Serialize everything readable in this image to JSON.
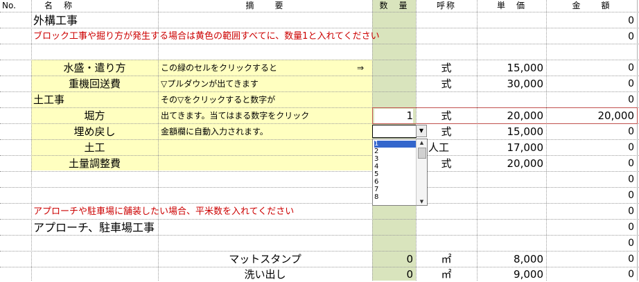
{
  "header": {
    "no": "No.",
    "name": "名　称",
    "summary": "摘　　要",
    "quantity": "数　量",
    "unit_name": "呼称",
    "unit_price": "単　価",
    "amount": "金　　額"
  },
  "rows": {
    "r1_name": "外構工事",
    "r1_amount": "0",
    "r2_notice": "ブロック工事や掘り方が発生する場合は黄色の範囲すべてに、数量1と入れてください",
    "r2_amount": "0",
    "r4_name": "水盛・遣り方",
    "r4_summary": "この緑のセルをクリックすると",
    "r4_arrow": "⇒",
    "r4_unit": "式",
    "r4_price": "15,000",
    "r4_amount": "0",
    "r5_name": "重機回送費",
    "r5_summary": "▽プルダウンが出てきます",
    "r5_unit": "式",
    "r5_price": "30,000",
    "r5_amount": "0",
    "r6_name": "土工事",
    "r6_summary": "その▽をクリックすると数字が",
    "r6_amount": "0",
    "r7_name": "堀方",
    "r7_summary": "出てきます。当てはまる数字をクリック",
    "r7_qty": "1",
    "r7_unit": "式",
    "r7_price": "20,000",
    "r7_amount": "20,000",
    "r8_name": "埋め戻し",
    "r8_summary": "金額欄に自動入力されます。",
    "r8_unit": "式",
    "r8_price": "15,000",
    "r8_amount": "0",
    "r9_name": "土工",
    "r9_unit": "人工",
    "r9_price": "17,000",
    "r9_amount": "0",
    "r10_name": "土量調整費",
    "r10_unit": "式",
    "r10_price": "20,000",
    "r10_amount": "0",
    "r11_amount": "0",
    "r12_amount": "0",
    "r13_notice": "アプローチや駐車場に舗装したい場合、平米数を入れてください",
    "r13_amount": "0",
    "r14_name": "アプローチ、駐車場工事",
    "r14_amount": "0",
    "r15_amount": "0",
    "r16_name": "マットスタンプ",
    "r16_qty": "0",
    "r16_unit": "㎡",
    "r16_price": "8,000",
    "r16_amount": "0",
    "r17_name": "洗い出し",
    "r17_qty": "0",
    "r17_unit": "㎡",
    "r17_price": "9,000",
    "r17_amount": "0"
  },
  "dropdown": {
    "options": [
      "1",
      "2",
      "3",
      "4",
      "5",
      "6",
      "7",
      "8"
    ],
    "selected": "1"
  },
  "colors": {
    "yellow_fill": "#ffffc0",
    "green_fill": "#d9e4bd",
    "notice_red": "#cc0000",
    "selection_blue": "#3366cc"
  }
}
